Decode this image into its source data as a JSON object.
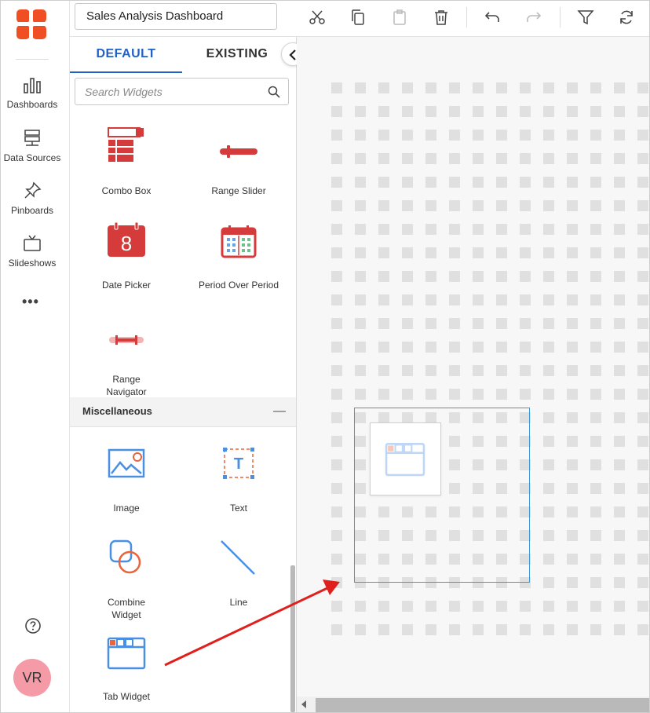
{
  "app": {
    "brand_color": "#f04e23",
    "accent": "#2161c7"
  },
  "nav": {
    "items": [
      {
        "label": "Dashboards",
        "icon": "bar-chart-icon"
      },
      {
        "label": "Data Sources",
        "icon": "server-icon"
      },
      {
        "label": "Pinboards",
        "icon": "pin-icon"
      },
      {
        "label": "Slideshows",
        "icon": "tv-icon"
      }
    ],
    "more": "•••",
    "help_icon": "help-circle-icon",
    "avatar": "VR"
  },
  "toolbar": {
    "title": "Sales Analysis Dashboard",
    "buttons": [
      "cut-icon",
      "copy-icon",
      "paste-icon",
      "delete-icon",
      "undo-icon",
      "redo-icon",
      "filter-icon",
      "refresh-icon"
    ]
  },
  "panel": {
    "tabs": {
      "default": "DEFAULT",
      "existing": "EXISTING"
    },
    "search_placeholder": "Search Widgets",
    "widgets_top": [
      {
        "label": "Combo Box",
        "icon": "combo-box-icon"
      },
      {
        "label": "Range Slider",
        "icon": "range-slider-icon"
      },
      {
        "label": "Date Picker",
        "icon": "date-picker-icon",
        "day": "8"
      },
      {
        "label": "Period Over Period",
        "icon": "period-over-period-icon"
      },
      {
        "label": "Range Navigator",
        "icon": "range-navigator-icon"
      }
    ],
    "misc_section": {
      "title": "Miscellaneous",
      "toggle": "—"
    },
    "widgets_misc": [
      {
        "label": "Image",
        "icon": "image-icon"
      },
      {
        "label": "Text",
        "icon": "text-icon",
        "glyph": "T"
      },
      {
        "label": "Combine Widget",
        "icon": "combine-widget-icon"
      },
      {
        "label": "Line",
        "icon": "line-icon"
      },
      {
        "label": "Tab Widget",
        "icon": "tab-widget-icon"
      }
    ]
  }
}
